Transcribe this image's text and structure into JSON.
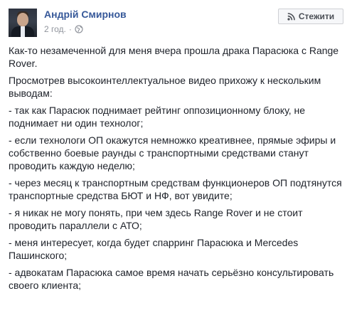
{
  "post": {
    "author": "Андрій Смирнов",
    "time": "2 год.",
    "separator": "·",
    "audience_icon": "globe-icon",
    "follow_label": "Стежити",
    "follow_icon": "rss-icon",
    "paragraphs": [
      "Как-то незамеченной для меня вчера прошла драка Парасюка с Range Rover.",
      "Просмотрев высокоинтеллектуальное видео прихожу к нескольким выводам:",
      "- так как Парасюк поднимает рейтинг оппозиционному блоку, не поднимает ни один технолог;",
      "- если технологи ОП окажутся немножко креативнее, прямые эфиры и собственно боевые раунды с транспортными средствами станут проводить каждую неделю;",
      "- через месяц к транспортным средствам функционеров ОП подтянутся транспортные средства БЮТ и НФ, вот увидите;",
      "- я никак не могу понять, при чем здесь Range Rover и не стоит проводить параллели с АТО;",
      "- меня интересует, когда будет спарринг Парасюка и Mercedes Пашинского;",
      "- адвокатам Парасюка самое время начать серьёзно консультировать своего клиента;"
    ]
  },
  "colors": {
    "link": "#365899",
    "text": "#1d2129",
    "meta": "#90949c",
    "button_bg": "#f6f7f9",
    "button_border": "#ced0d4"
  }
}
